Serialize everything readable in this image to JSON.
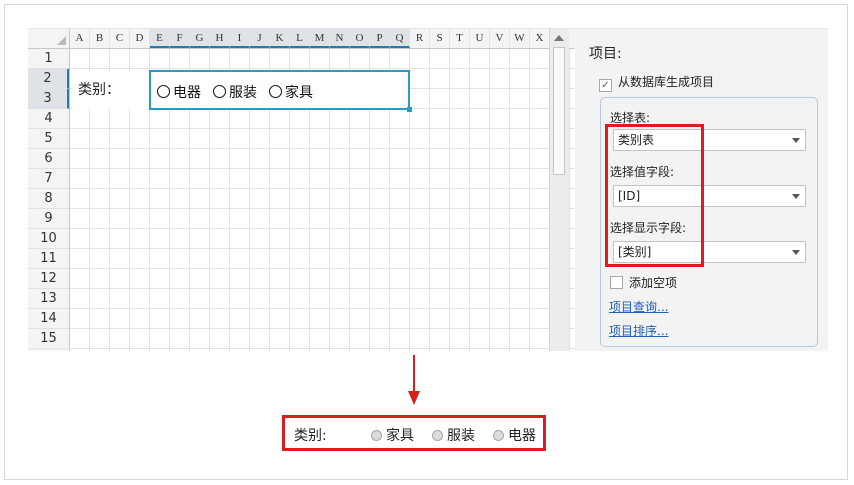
{
  "sheet": {
    "columns": [
      "A",
      "B",
      "C",
      "D",
      "E",
      "F",
      "G",
      "H",
      "I",
      "J",
      "K",
      "L",
      "M",
      "N",
      "O",
      "P",
      "Q",
      "R",
      "S",
      "T",
      "U",
      "V",
      "W",
      "X"
    ],
    "rows": [
      "1",
      "2",
      "3",
      "4",
      "5",
      "6",
      "7",
      "8",
      "9",
      "10",
      "11",
      "12",
      "13",
      "14",
      "15"
    ],
    "label_cell": "类别：",
    "radio_options": [
      "电器",
      "服装",
      "家具"
    ]
  },
  "panel": {
    "title": "项目:",
    "from_db_checked": true,
    "from_db_label": "从数据库生成项目",
    "table_label": "选择表:",
    "table_value": "类别表",
    "value_field_label": "选择值字段:",
    "value_field_value": "[ID]",
    "display_field_label": "选择显示字段:",
    "display_field_value": "[类别]",
    "add_empty_checked": false,
    "add_empty_label": "添加空项",
    "link_query": "项目查询...",
    "link_sort": "项目排序..."
  },
  "result": {
    "label": "类别:",
    "options": [
      "家具",
      "服装",
      "电器"
    ]
  },
  "colors": {
    "highlight": "#d81e1e",
    "selection": "#2a9ac3",
    "link": "#1f5fb5"
  }
}
